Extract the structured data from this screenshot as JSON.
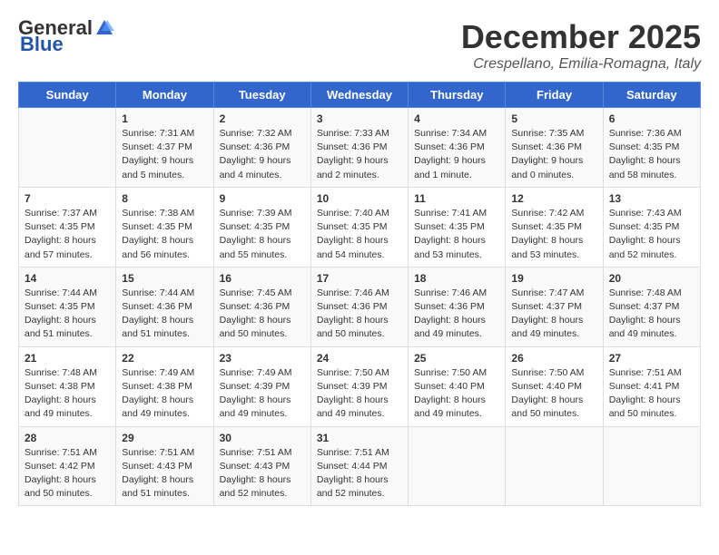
{
  "logo": {
    "general": "General",
    "blue": "Blue"
  },
  "header": {
    "month": "December 2025",
    "subtitle": "Crespellano, Emilia-Romagna, Italy"
  },
  "days_of_week": [
    "Sunday",
    "Monday",
    "Tuesday",
    "Wednesday",
    "Thursday",
    "Friday",
    "Saturday"
  ],
  "weeks": [
    [
      {
        "day": "",
        "sunrise": "",
        "sunset": "",
        "daylight": ""
      },
      {
        "day": "1",
        "sunrise": "Sunrise: 7:31 AM",
        "sunset": "Sunset: 4:37 PM",
        "daylight": "Daylight: 9 hours and 5 minutes."
      },
      {
        "day": "2",
        "sunrise": "Sunrise: 7:32 AM",
        "sunset": "Sunset: 4:36 PM",
        "daylight": "Daylight: 9 hours and 4 minutes."
      },
      {
        "day": "3",
        "sunrise": "Sunrise: 7:33 AM",
        "sunset": "Sunset: 4:36 PM",
        "daylight": "Daylight: 9 hours and 2 minutes."
      },
      {
        "day": "4",
        "sunrise": "Sunrise: 7:34 AM",
        "sunset": "Sunset: 4:36 PM",
        "daylight": "Daylight: 9 hours and 1 minute."
      },
      {
        "day": "5",
        "sunrise": "Sunrise: 7:35 AM",
        "sunset": "Sunset: 4:36 PM",
        "daylight": "Daylight: 9 hours and 0 minutes."
      },
      {
        "day": "6",
        "sunrise": "Sunrise: 7:36 AM",
        "sunset": "Sunset: 4:35 PM",
        "daylight": "Daylight: 8 hours and 58 minutes."
      }
    ],
    [
      {
        "day": "7",
        "sunrise": "Sunrise: 7:37 AM",
        "sunset": "Sunset: 4:35 PM",
        "daylight": "Daylight: 8 hours and 57 minutes."
      },
      {
        "day": "8",
        "sunrise": "Sunrise: 7:38 AM",
        "sunset": "Sunset: 4:35 PM",
        "daylight": "Daylight: 8 hours and 56 minutes."
      },
      {
        "day": "9",
        "sunrise": "Sunrise: 7:39 AM",
        "sunset": "Sunset: 4:35 PM",
        "daylight": "Daylight: 8 hours and 55 minutes."
      },
      {
        "day": "10",
        "sunrise": "Sunrise: 7:40 AM",
        "sunset": "Sunset: 4:35 PM",
        "daylight": "Daylight: 8 hours and 54 minutes."
      },
      {
        "day": "11",
        "sunrise": "Sunrise: 7:41 AM",
        "sunset": "Sunset: 4:35 PM",
        "daylight": "Daylight: 8 hours and 53 minutes."
      },
      {
        "day": "12",
        "sunrise": "Sunrise: 7:42 AM",
        "sunset": "Sunset: 4:35 PM",
        "daylight": "Daylight: 8 hours and 53 minutes."
      },
      {
        "day": "13",
        "sunrise": "Sunrise: 7:43 AM",
        "sunset": "Sunset: 4:35 PM",
        "daylight": "Daylight: 8 hours and 52 minutes."
      }
    ],
    [
      {
        "day": "14",
        "sunrise": "Sunrise: 7:44 AM",
        "sunset": "Sunset: 4:35 PM",
        "daylight": "Daylight: 8 hours and 51 minutes."
      },
      {
        "day": "15",
        "sunrise": "Sunrise: 7:44 AM",
        "sunset": "Sunset: 4:36 PM",
        "daylight": "Daylight: 8 hours and 51 minutes."
      },
      {
        "day": "16",
        "sunrise": "Sunrise: 7:45 AM",
        "sunset": "Sunset: 4:36 PM",
        "daylight": "Daylight: 8 hours and 50 minutes."
      },
      {
        "day": "17",
        "sunrise": "Sunrise: 7:46 AM",
        "sunset": "Sunset: 4:36 PM",
        "daylight": "Daylight: 8 hours and 50 minutes."
      },
      {
        "day": "18",
        "sunrise": "Sunrise: 7:46 AM",
        "sunset": "Sunset: 4:36 PM",
        "daylight": "Daylight: 8 hours and 49 minutes."
      },
      {
        "day": "19",
        "sunrise": "Sunrise: 7:47 AM",
        "sunset": "Sunset: 4:37 PM",
        "daylight": "Daylight: 8 hours and 49 minutes."
      },
      {
        "day": "20",
        "sunrise": "Sunrise: 7:48 AM",
        "sunset": "Sunset: 4:37 PM",
        "daylight": "Daylight: 8 hours and 49 minutes."
      }
    ],
    [
      {
        "day": "21",
        "sunrise": "Sunrise: 7:48 AM",
        "sunset": "Sunset: 4:38 PM",
        "daylight": "Daylight: 8 hours and 49 minutes."
      },
      {
        "day": "22",
        "sunrise": "Sunrise: 7:49 AM",
        "sunset": "Sunset: 4:38 PM",
        "daylight": "Daylight: 8 hours and 49 minutes."
      },
      {
        "day": "23",
        "sunrise": "Sunrise: 7:49 AM",
        "sunset": "Sunset: 4:39 PM",
        "daylight": "Daylight: 8 hours and 49 minutes."
      },
      {
        "day": "24",
        "sunrise": "Sunrise: 7:50 AM",
        "sunset": "Sunset: 4:39 PM",
        "daylight": "Daylight: 8 hours and 49 minutes."
      },
      {
        "day": "25",
        "sunrise": "Sunrise: 7:50 AM",
        "sunset": "Sunset: 4:40 PM",
        "daylight": "Daylight: 8 hours and 49 minutes."
      },
      {
        "day": "26",
        "sunrise": "Sunrise: 7:50 AM",
        "sunset": "Sunset: 4:40 PM",
        "daylight": "Daylight: 8 hours and 50 minutes."
      },
      {
        "day": "27",
        "sunrise": "Sunrise: 7:51 AM",
        "sunset": "Sunset: 4:41 PM",
        "daylight": "Daylight: 8 hours and 50 minutes."
      }
    ],
    [
      {
        "day": "28",
        "sunrise": "Sunrise: 7:51 AM",
        "sunset": "Sunset: 4:42 PM",
        "daylight": "Daylight: 8 hours and 50 minutes."
      },
      {
        "day": "29",
        "sunrise": "Sunrise: 7:51 AM",
        "sunset": "Sunset: 4:43 PM",
        "daylight": "Daylight: 8 hours and 51 minutes."
      },
      {
        "day": "30",
        "sunrise": "Sunrise: 7:51 AM",
        "sunset": "Sunset: 4:43 PM",
        "daylight": "Daylight: 8 hours and 52 minutes."
      },
      {
        "day": "31",
        "sunrise": "Sunrise: 7:51 AM",
        "sunset": "Sunset: 4:44 PM",
        "daylight": "Daylight: 8 hours and 52 minutes."
      },
      {
        "day": "",
        "sunrise": "",
        "sunset": "",
        "daylight": ""
      },
      {
        "day": "",
        "sunrise": "",
        "sunset": "",
        "daylight": ""
      },
      {
        "day": "",
        "sunrise": "",
        "sunset": "",
        "daylight": ""
      }
    ]
  ]
}
